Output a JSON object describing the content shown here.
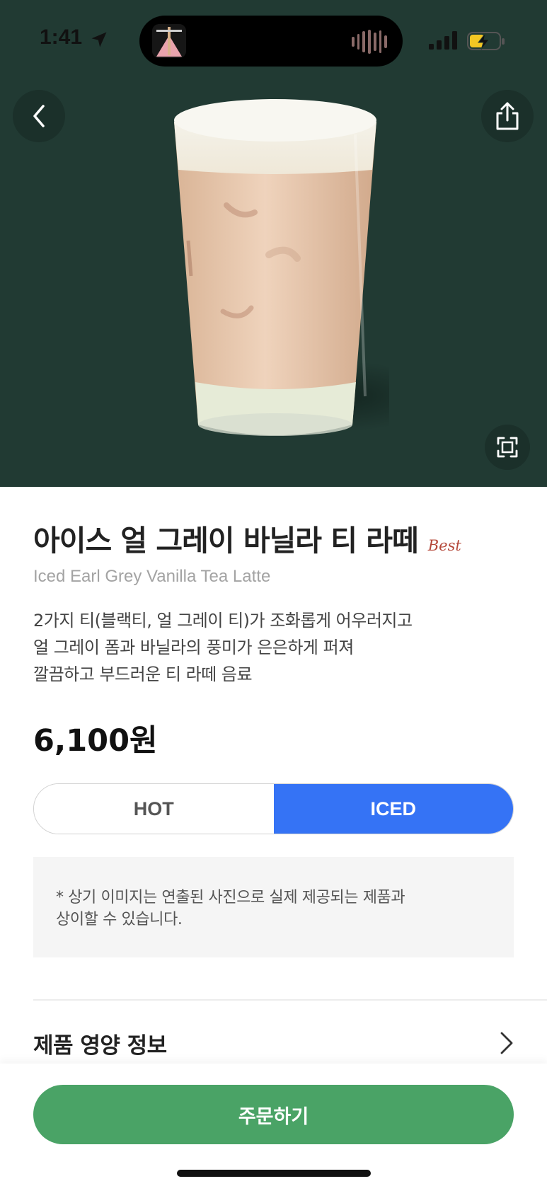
{
  "status_bar": {
    "time": "1:41",
    "icons": [
      "location-arrow-icon",
      "signal-icon",
      "battery-charging-icon"
    ]
  },
  "hero": {
    "background_color": "#213a33",
    "buttons": [
      "back-icon",
      "share-icon",
      "expand-icon"
    ]
  },
  "product": {
    "name_ko": "아이스 얼 그레이 바닐라 티 라떼",
    "badge": "Best",
    "name_en": "Iced Earl Grey Vanilla Tea Latte",
    "description": [
      "2가지 티(블랙티, 얼 그레이 티)가 조화롭게 어우러지고",
      "얼 그레이 폼과 바닐라의 풍미가 은은하게 퍼져",
      "깔끔하고 부드러운 티 라떼 음료"
    ],
    "price": "6,100원"
  },
  "temperature": {
    "options": [
      "HOT",
      "ICED"
    ],
    "selected": "ICED",
    "accent_color": "#3573f5"
  },
  "notice": {
    "lines": [
      "* 상기 이미지는 연출된 사진으로 실제 제공되는 제품과",
      "상이할 수 있습니다."
    ]
  },
  "nutrition": {
    "label": "제품 영양 정보"
  },
  "order": {
    "label": "주문하기",
    "color": "#4aa366"
  }
}
